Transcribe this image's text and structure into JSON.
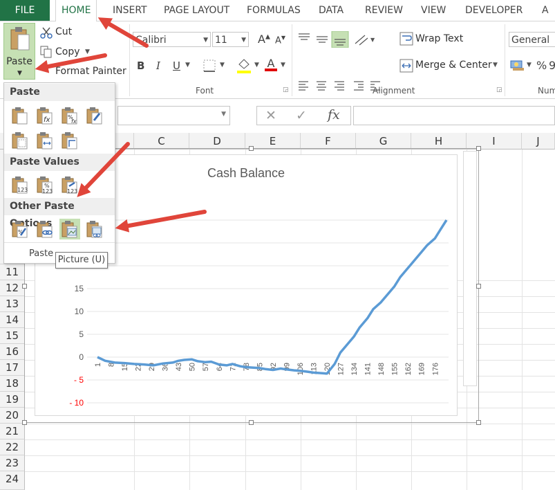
{
  "ribbon": {
    "tabs": [
      "FILE",
      "HOME",
      "INSERT",
      "PAGE LAYOUT",
      "FORMULAS",
      "DATA",
      "REVIEW",
      "VIEW",
      "DEVELOPER",
      "A"
    ],
    "clipboard": {
      "paste": "Paste",
      "cut": "Cut",
      "copy": "Copy",
      "format_painter": "Format Painter"
    },
    "font": {
      "name": "Calibri",
      "size": "11",
      "bold": "B",
      "italic": "I",
      "underline": "U",
      "grow": "A",
      "shrink": "A",
      "font_color": "A",
      "group_label": "Font"
    },
    "alignment": {
      "wrap_text": "Wrap Text",
      "merge_center": "Merge & Center",
      "group_label": "Alignment"
    },
    "number": {
      "format": "General",
      "percent": "%",
      "comma": "9",
      "group_label": "Num"
    }
  },
  "formula_bar": {
    "cancel": "✕",
    "enter": "✓",
    "fx": "fx",
    "value": ""
  },
  "columns": [
    "C",
    "D",
    "E",
    "F",
    "G",
    "H",
    "I",
    "J"
  ],
  "rows": [
    "11",
    "12",
    "13",
    "14",
    "15",
    "16",
    "17",
    "18",
    "19",
    "20",
    "21",
    "22",
    "23",
    "24"
  ],
  "paste_menu": {
    "sections": [
      "Paste",
      "Paste Values",
      "Other Paste Options"
    ],
    "footer": "Paste",
    "tooltip": "Picture (U)",
    "icons": {
      "paste": [
        "paste-icon",
        "paste-formulas-icon",
        "paste-formulas-number-formatting-icon",
        "keep-source-formatting-icon",
        "no-borders-icon",
        "keep-source-column-widths-icon",
        "transpose-icon"
      ],
      "values": [
        "values-icon",
        "values-number-formatting-icon",
        "values-source-formatting-icon"
      ],
      "other": [
        "formatting-icon",
        "paste-link-icon",
        "picture-icon",
        "linked-picture-icon"
      ]
    }
  },
  "chart_data": {
    "type": "line",
    "title": "Cash Balance",
    "xlabel": "",
    "ylabel": "",
    "ylim": [
      -10,
      20
    ],
    "yticks": [
      {
        "label": "15",
        "value": 15
      },
      {
        "label": "10",
        "value": 10
      },
      {
        "label": "5",
        "value": 5
      },
      {
        "label": "0",
        "value": 0
      },
      {
        "label": "- 5",
        "value": -5
      },
      {
        "label": "- 10",
        "value": -10
      }
    ],
    "xticks": [
      "1",
      "8",
      "15",
      "22",
      "29",
      "36",
      "43",
      "50",
      "57",
      "64",
      "71",
      "78",
      "85",
      "92",
      "99",
      "106",
      "113",
      "120",
      "127",
      "134",
      "141",
      "148",
      "155",
      "162",
      "169",
      "176"
    ],
    "xlim": [
      1,
      182
    ],
    "line_color": "#5b9bd5",
    "negative_label_color": "#ff0000",
    "series": [
      {
        "x": [
          1,
          5,
          10,
          15,
          20,
          25,
          30,
          35,
          40,
          43,
          46,
          50,
          53,
          57,
          60,
          64,
          68,
          71,
          75,
          78,
          82,
          85,
          88,
          92,
          96,
          99,
          103,
          106,
          110,
          113,
          117,
          120,
          124,
          127,
          130,
          134,
          137,
          141,
          144,
          148,
          152,
          155,
          158,
          162,
          165,
          169,
          172,
          176,
          179,
          182
        ],
        "values": [
          0,
          -0.8,
          -1.2,
          -1.3,
          -1.5,
          -1.6,
          -1.8,
          -1.4,
          -1.2,
          -0.8,
          -0.6,
          -0.5,
          -0.9,
          -1.1,
          -1.0,
          -1.6,
          -1.8,
          -1.5,
          -2.0,
          -2.2,
          -2.3,
          -2.4,
          -2.6,
          -2.8,
          -2.5,
          -2.7,
          -2.9,
          -3.0,
          -3.2,
          -3.4,
          -3.5,
          -3.6,
          -1.5,
          1.0,
          2.5,
          4.5,
          6.5,
          8.5,
          10.5,
          12.0,
          14.0,
          15.5,
          17.5,
          19.5,
          21.0,
          23.0,
          24.5,
          26.0,
          28.0,
          30.0
        ]
      }
    ]
  },
  "colors": {
    "excel_green": "#217346",
    "arrow_red": "#e0453a",
    "paste_highlight": "#c6e0b4"
  }
}
